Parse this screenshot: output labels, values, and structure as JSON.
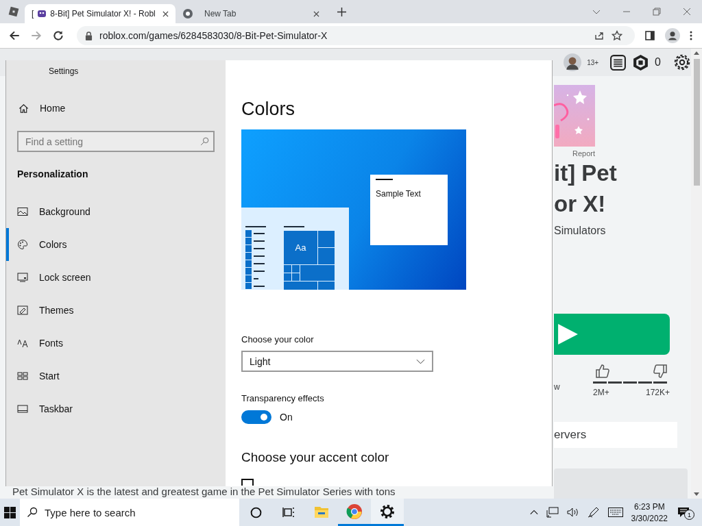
{
  "browser": {
    "tabs": [
      {
        "prefix": "[",
        "label": "8-Bit] Pet Simulator X! - Robl",
        "selected": true
      },
      {
        "label": "New Tab",
        "selected": false
      }
    ],
    "address": "roblox.com/games/6284583030/8-Bit-Pet-Simulator-X"
  },
  "roblox": {
    "age_badge": "13+",
    "robux": "0",
    "report": "Report",
    "title_lines": [
      "it] Pet",
      "or X!"
    ],
    "creator": "Simulators",
    "vote_label": "w",
    "likes": "2M+",
    "dislikes": "172K+",
    "servers": "ervers",
    "description": "Pet Simulator X is the latest and greatest game in the Pet Simulator Series with tons"
  },
  "settings": {
    "title": "Settings",
    "home": "Home",
    "search_placeholder": "Find a setting",
    "section": "Personalization",
    "nav": [
      {
        "label": "Background",
        "selected": false
      },
      {
        "label": "Colors",
        "selected": true
      },
      {
        "label": "Lock screen",
        "selected": false
      },
      {
        "label": "Themes",
        "selected": false
      },
      {
        "label": "Fonts",
        "selected": false
      },
      {
        "label": "Start",
        "selected": false
      },
      {
        "label": "Taskbar",
        "selected": false
      }
    ],
    "heading": "Colors",
    "sample_text": "Sample Text",
    "tile_text": "Aa",
    "color_label": "Choose your color",
    "color_value": "Light",
    "transparency_label": "Transparency effects",
    "transparency": {
      "on": true,
      "state_text": "On"
    },
    "accent_heading": "Choose your accent color",
    "auto_accent_checked": false
  },
  "taskbar": {
    "search_placeholder": "Type here to search",
    "apps": [
      {
        "running": false,
        "selected": false
      },
      {
        "running": true,
        "selected": false
      },
      {
        "running": true,
        "selected": true
      }
    ],
    "time": "6:23 PM",
    "date": "3/30/2022",
    "notifications": "1"
  }
}
